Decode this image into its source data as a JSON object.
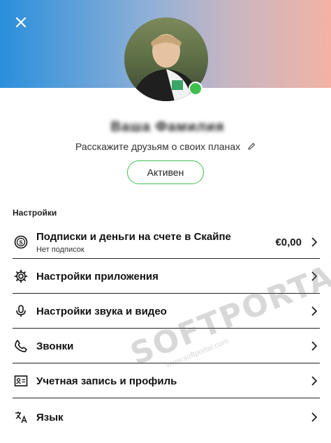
{
  "header": {
    "close_icon": "close-icon",
    "gradient_colors": [
      "#2a8fdb",
      "#f2b3a4"
    ]
  },
  "profile": {
    "name": "Ваша Фамилия",
    "mood": "Расскажите друзьям о своих планах",
    "status": "Активен",
    "status_color": "#3fbf4f"
  },
  "settings": {
    "title": "Настройки",
    "items": [
      {
        "label": "Подписки и деньги на счете в Скайпе",
        "sub": "Нет подписок",
        "value": "€0,00",
        "icon": "skype-credit-icon"
      },
      {
        "label": "Настройки приложения",
        "icon": "gear-icon"
      },
      {
        "label": "Настройки звука и видео",
        "icon": "microphone-icon"
      },
      {
        "label": "Звонки",
        "icon": "phone-icon"
      },
      {
        "label": "Учетная запись и профиль",
        "icon": "account-card-icon"
      },
      {
        "label": "Язык",
        "icon": "language-icon"
      }
    ]
  },
  "watermark": {
    "text": "SOFTPORTAL",
    "url": "www.softportal.com"
  }
}
